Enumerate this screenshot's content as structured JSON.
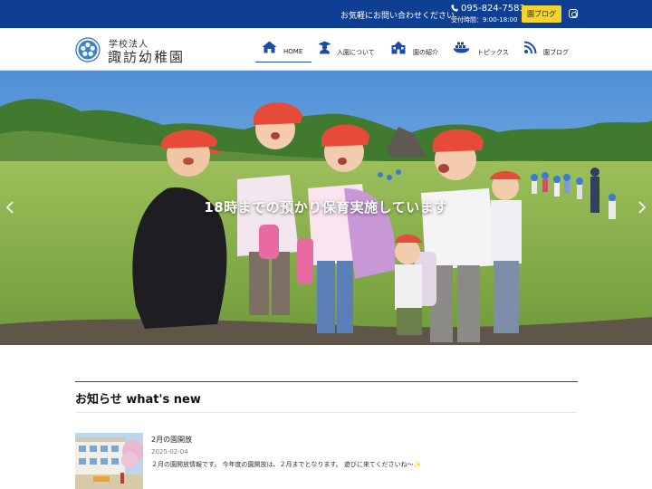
{
  "topbar": {
    "contact_text": "お気軽にお問い合わせください",
    "phone": "095-824-7583",
    "hours": "受付時間：9:00-18:00",
    "blog_button": "園ブログ",
    "instagram_icon": "instagram-icon"
  },
  "logo": {
    "small_text": "学校法人",
    "name": "諏訪幼稚園"
  },
  "nav": [
    {
      "label": "HOME",
      "icon": "home-icon"
    },
    {
      "label": "入園について",
      "icon": "graduate-icon"
    },
    {
      "label": "園の紹介",
      "icon": "building-icon"
    },
    {
      "label": "トピックス",
      "icon": "ship-icon"
    },
    {
      "label": "園ブログ",
      "icon": "feed-icon"
    }
  ],
  "hero": {
    "caption": "18時までの預かり保育実施しています"
  },
  "news": {
    "heading": "お知らせ what's new",
    "items": [
      {
        "title": "2月の園開放",
        "date": "2025-02-04",
        "excerpt": "２月の園開放情報です。 今年度の園開放は、２月までとなります。 遊びに来てくださいね〜✨"
      }
    ]
  },
  "colors": {
    "topbar_bg": "#0f3f92",
    "blog_button_bg": "#f6d22c",
    "accent": "#1a4da8"
  }
}
